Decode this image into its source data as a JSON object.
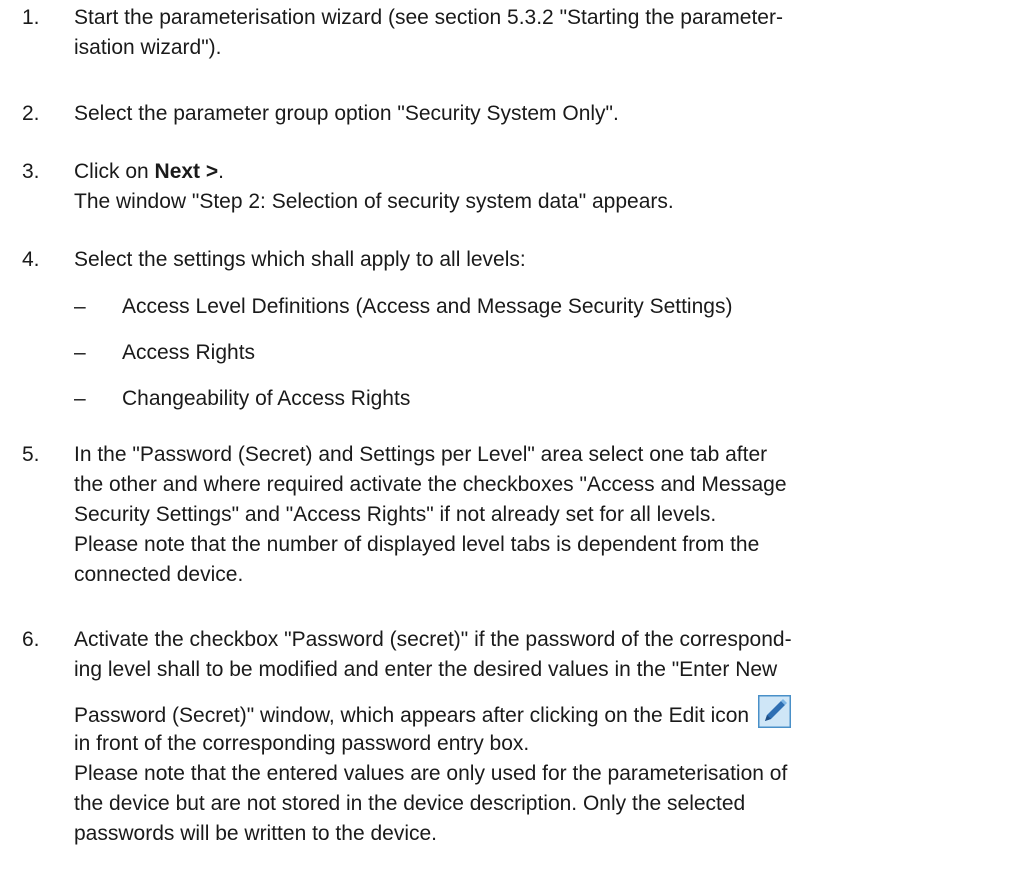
{
  "steps": [
    {
      "num": "1.",
      "line1": "Start the parameterisation wizard (see section 5.3.2 \"Starting the parameter-",
      "line2": "isation wizard\")."
    },
    {
      "num": "2.",
      "line1": "Select the parameter group option \"Security System Only\"."
    },
    {
      "num": "3.",
      "prefix": "Click on ",
      "bold": "Next >",
      "suffix": ".",
      "line2": "The window \"Step 2: Selection of security system data\" appears."
    },
    {
      "num": "4.",
      "line1": "Select the settings which shall apply to all levels:",
      "bullets": [
        "Access Level Definitions (Access and Message Security Settings)",
        "Access Rights",
        "Changeability of Access Rights"
      ],
      "dash": "–"
    },
    {
      "num": "5.",
      "lines": [
        "In the \"Password (Secret) and Settings per Level\" area select one tab after",
        "the other and where required activate the checkboxes \"Access and Message",
        "Security Settings\" and \"Access Rights\" if not already set for all levels.",
        "Please note that the number of displayed level tabs is dependent from the",
        "connected device."
      ]
    },
    {
      "num": "6.",
      "lines": [
        "Activate the checkbox \"Password (secret)\" if the password of the correspond-",
        "ing level shall to be modified and enter the desired values in the \"Enter New",
        "Password (Secret)\" window, which appears after clicking on the Edit icon",
        "in front of the corresponding password entry box.",
        "Please note that the entered values are only used for the parameterisation of",
        "the device but are not stored in the device description. Only the selected",
        "passwords will be written to the device."
      ],
      "icon": "edit-pencil-icon"
    }
  ],
  "colors": {
    "text": "#1a1a1a",
    "icon_bg": "#cfe6f7",
    "icon_border": "#4a90c8",
    "pencil": "#2f6fb3"
  }
}
